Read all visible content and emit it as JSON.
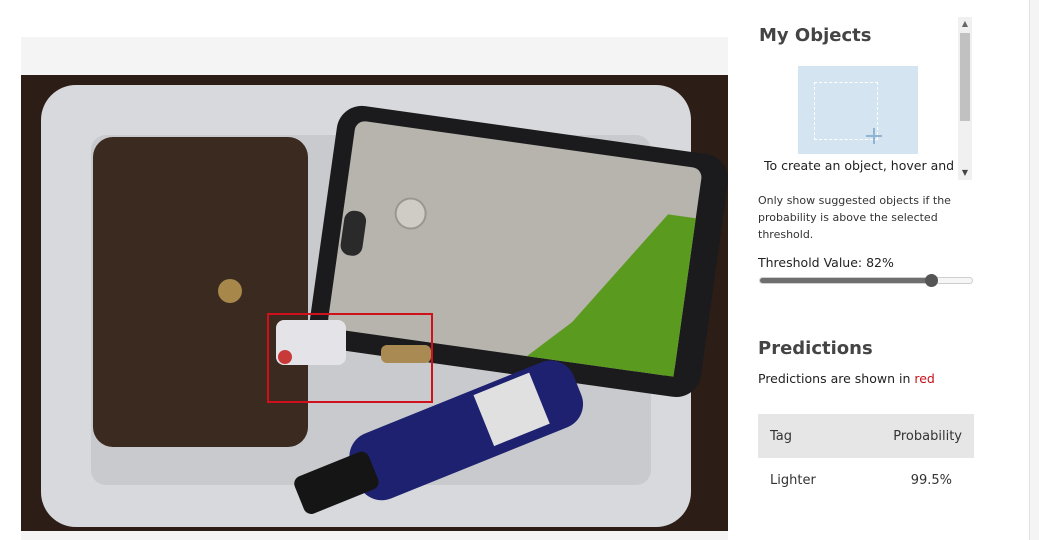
{
  "objects_panel": {
    "title": "My Objects",
    "hint": "To create an object, hover and"
  },
  "threshold": {
    "note": "Only show suggested objects if the probability is above the selected threshold.",
    "label": "Threshold Value: 82%",
    "value_percent": 82
  },
  "predictions": {
    "title": "Predictions",
    "subtitle_prefix": "Predictions are shown in ",
    "subtitle_color_word": "red",
    "table": {
      "headers": [
        "Tag",
        "Probability"
      ],
      "rows": [
        {
          "tag": "Lighter",
          "probability": "99.5%"
        }
      ]
    }
  },
  "colors": {
    "bbox": "#d0101a",
    "tile": "#d5e4f1"
  }
}
